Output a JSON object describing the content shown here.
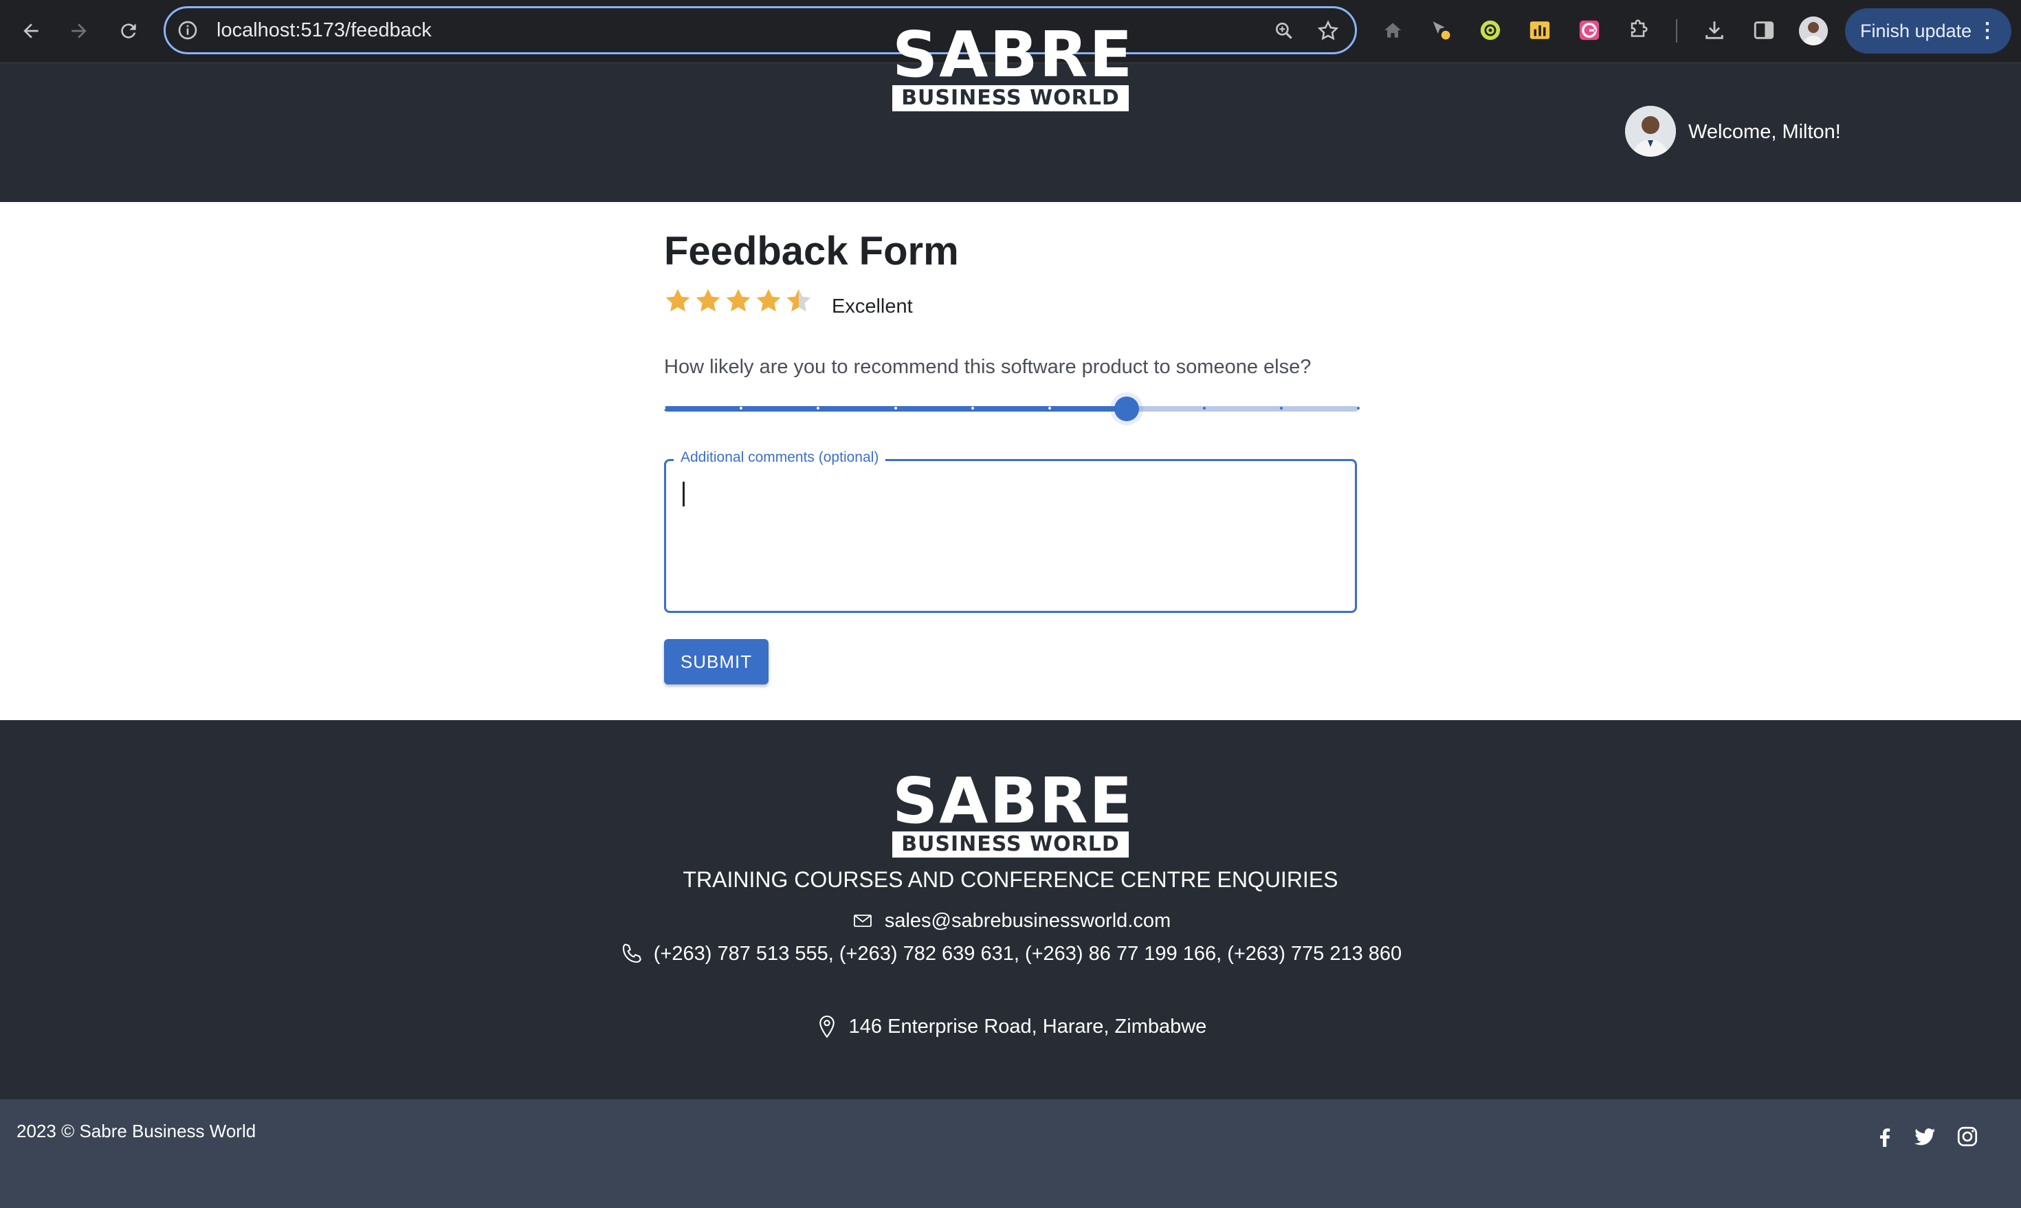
{
  "browser": {
    "url": "localhost:5173/feedback",
    "finish_update_label": "Finish update",
    "menu_glyph": "⋮"
  },
  "header": {
    "logo_word": "SABRE",
    "logo_sub": "BUSINESS WORLD",
    "welcome": "Welcome, Milton!"
  },
  "form": {
    "title": "Feedback Form",
    "rating_value": 4.5,
    "rating_max": 5,
    "rating_label": "Excellent",
    "question": "How likely are you to recommend this software product to someone else?",
    "slider_value": 7,
    "slider_min": 1,
    "slider_max": 10,
    "comments_label": "Additional comments (optional)",
    "comments_value": "",
    "submit_label": "SUBMIT"
  },
  "footer": {
    "logo_word": "SABRE",
    "logo_sub": "BUSINESS WORLD",
    "heading": "TRAINING COURSES AND CONFERENCE CENTRE ENQUIRIES",
    "email": "sales@sabrebusinessworld.com",
    "phones": "(+263) 787 513 555, (+263) 782 639 631, (+263) 86 77 199 166, (+263) 775 213 860",
    "address": "146 Enterprise Road, Harare, Zimbabwe",
    "copyright": "2023 © Sabre Business World"
  },
  "colors": {
    "accent": "#3a6fc8",
    "star": "#f0b03f",
    "header_bg": "#282d35",
    "bottom_bar_bg": "#3b4555"
  },
  "icons": [
    "back-arrow-icon",
    "forward-arrow-icon",
    "reload-icon",
    "info-icon",
    "zoom-icon",
    "bookmark-star-icon",
    "home-extension-icon",
    "cursor-extension-icon",
    "green-extension-icon",
    "chart-extension-icon",
    "grammarly-extension-icon",
    "puzzle-extensions-icon",
    "download-icon",
    "side-panel-icon",
    "mail-icon",
    "phone-icon",
    "location-pin-icon",
    "facebook-icon",
    "twitter-icon",
    "instagram-icon"
  ]
}
